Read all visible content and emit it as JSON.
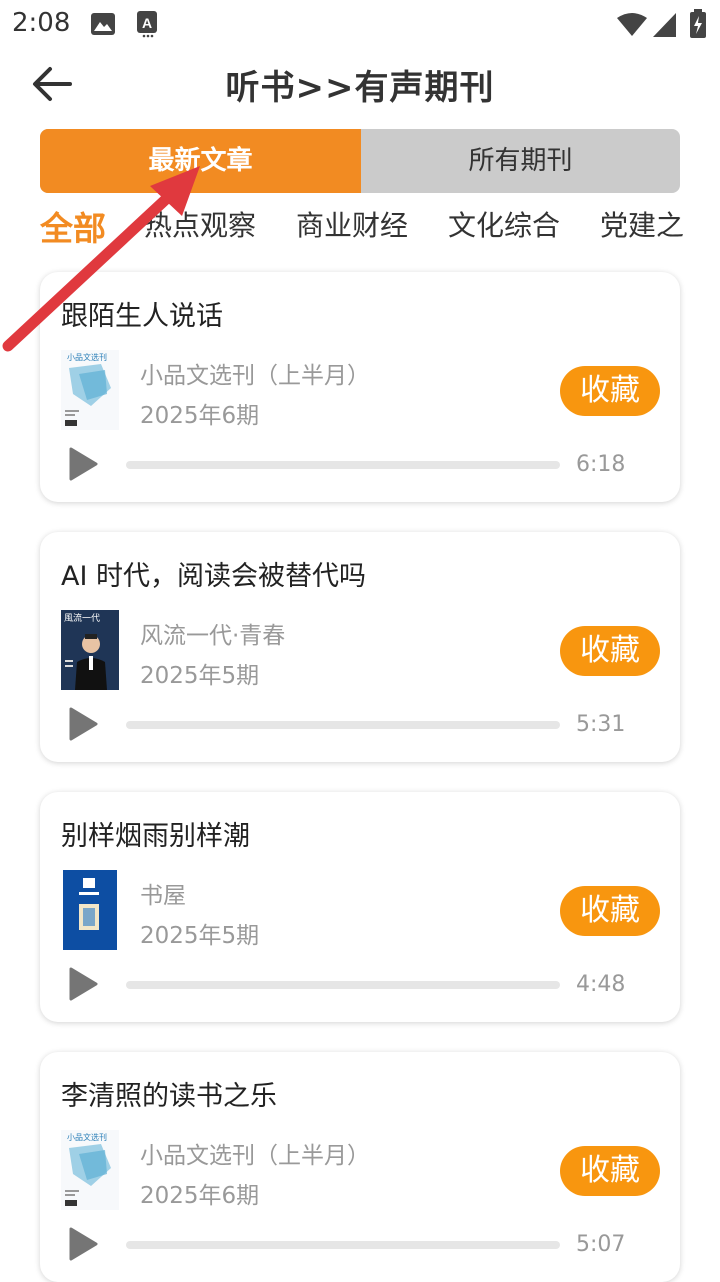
{
  "status_bar": {
    "time": "2:08"
  },
  "header": {
    "title": "听书>>有声期刊",
    "back_icon": "arrow-left-icon"
  },
  "segments": [
    {
      "label": "最新文章",
      "active": true
    },
    {
      "label": "所有期刊",
      "active": false
    }
  ],
  "categories": [
    {
      "label": "全部",
      "active": true
    },
    {
      "label": "热点观察"
    },
    {
      "label": "商业财经"
    },
    {
      "label": "文化综合"
    },
    {
      "label": "党建之"
    }
  ],
  "articles": [
    {
      "title": "跟陌生人说话",
      "publication": "小品文选刊（上半月）",
      "issue": "2025年6期",
      "favorite_label": "收藏",
      "duration": "6:18",
      "progress": 0,
      "cover": "xiaopinwen"
    },
    {
      "title": "AI 时代，阅读会被替代吗",
      "publication": "风流一代·青春",
      "issue": "2025年5期",
      "favorite_label": "收藏",
      "duration": "5:31",
      "progress": 0,
      "cover": "fengliu"
    },
    {
      "title": "别样烟雨别样潮",
      "publication": "书屋",
      "issue": "2025年5期",
      "favorite_label": "收藏",
      "duration": "4:48",
      "progress": 0,
      "cover": "shuwu"
    },
    {
      "title": "李清照的读书之乐",
      "publication": "小品文选刊（上半月）",
      "issue": "2025年6期",
      "favorite_label": "收藏",
      "duration": "5:07",
      "progress": 0,
      "cover": "xiaopinwen"
    }
  ],
  "colors": {
    "accent": "#f28b22",
    "favorite": "#f8960f",
    "annotation_arrow": "#e0393e"
  }
}
